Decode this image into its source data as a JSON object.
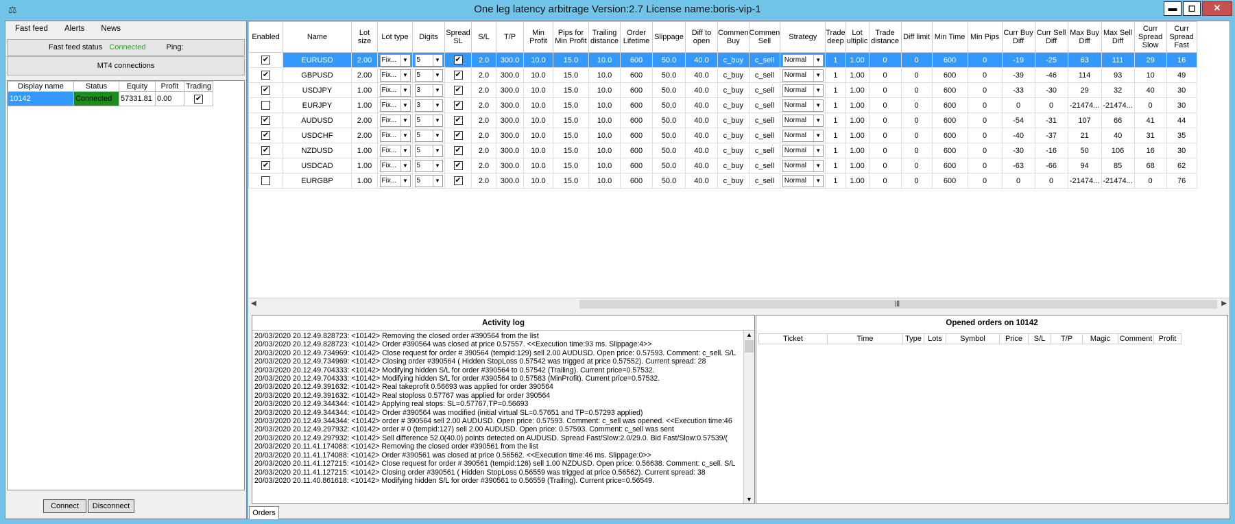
{
  "window": {
    "icon": "⚖",
    "title": "One leg latency arbitrage Version:2.7 License name:boris-vip-1",
    "min": "▬",
    "max": "◻",
    "close": "✕"
  },
  "menu": [
    "Fast feed",
    "Alerts",
    "News"
  ],
  "feed": {
    "status_label": "Fast feed status",
    "status_value": "Connected",
    "status_color": "#2e9e2e",
    "ping_label": "Ping:"
  },
  "mt4_button": "MT4 connections",
  "accounts": {
    "headers": [
      "Display name",
      "Status",
      "Equity",
      "Profit",
      "Trading"
    ],
    "rows": [
      {
        "name": "10142",
        "status": "Connected",
        "equity": "57331.81",
        "profit": "0.00",
        "trading": "✔"
      }
    ]
  },
  "buttons": {
    "connect": "Connect",
    "disconnect": "Disconnect"
  },
  "grid": {
    "headers": [
      "Enabled",
      "Name",
      "Lot size",
      "Lot type",
      "Digits",
      "Spread SL",
      "S/L",
      "T/P",
      "Min Profit",
      "Pips for Min Profit",
      "Trailing distance",
      "Order Lifetime",
      "Slippage",
      "Diff to open",
      "Commen Buy",
      "Commen Sell",
      "Strategy",
      "Trade deep",
      "Lot ultiplic",
      "Trade distance",
      "Diff limit",
      "Min Time",
      "Min Pips",
      "Curr Buy Diff",
      "Curr Sell Diff",
      "Max Buy Diff",
      "Max Sell Diff",
      "Curr Spread Slow",
      "Curr Spread Fast"
    ],
    "rows": [
      [
        "✔",
        "EURUSD",
        "2.00",
        "Fix...",
        "5",
        "✔",
        "2.0",
        "300.0",
        "10.0",
        "15.0",
        "10.0",
        "600",
        "50.0",
        "40.0",
        "c_buy",
        "c_sell",
        "Normal",
        "1",
        "1.00",
        "0",
        "0",
        "600",
        "0",
        "-19",
        "-25",
        "63",
        "111",
        "29",
        "16"
      ],
      [
        "✔",
        "GBPUSD",
        "2.00",
        "Fix...",
        "5",
        "✔",
        "2.0",
        "300.0",
        "10.0",
        "15.0",
        "10.0",
        "600",
        "50.0",
        "40.0",
        "c_buy",
        "c_sell",
        "Normal",
        "1",
        "1.00",
        "0",
        "0",
        "600",
        "0",
        "-39",
        "-46",
        "114",
        "93",
        "10",
        "49"
      ],
      [
        "✔",
        "USDJPY",
        "1.00",
        "Fix...",
        "3",
        "✔",
        "2.0",
        "300.0",
        "10.0",
        "15.0",
        "10.0",
        "600",
        "50.0",
        "40.0",
        "c_buy",
        "c_sell",
        "Normal",
        "1",
        "1.00",
        "0",
        "0",
        "600",
        "0",
        "-33",
        "-30",
        "29",
        "32",
        "40",
        "30"
      ],
      [
        "",
        "EURJPY",
        "1.00",
        "Fix...",
        "3",
        "✔",
        "2.0",
        "300.0",
        "10.0",
        "15.0",
        "10.0",
        "600",
        "50.0",
        "40.0",
        "c_buy",
        "c_sell",
        "Normal",
        "1",
        "1.00",
        "0",
        "0",
        "600",
        "0",
        "0",
        "0",
        "-21474...",
        "-21474...",
        "0",
        "30"
      ],
      [
        "✔",
        "AUDUSD",
        "2.00",
        "Fix...",
        "5",
        "✔",
        "2.0",
        "300.0",
        "10.0",
        "15.0",
        "10.0",
        "600",
        "50.0",
        "40.0",
        "c_buy",
        "c_sell",
        "Normal",
        "1",
        "1.00",
        "0",
        "0",
        "600",
        "0",
        "-54",
        "-31",
        "107",
        "66",
        "41",
        "44"
      ],
      [
        "✔",
        "USDCHF",
        "2.00",
        "Fix...",
        "5",
        "✔",
        "2.0",
        "300.0",
        "10.0",
        "15.0",
        "10.0",
        "600",
        "50.0",
        "40.0",
        "c_buy",
        "c_sell",
        "Normal",
        "1",
        "1.00",
        "0",
        "0",
        "600",
        "0",
        "-40",
        "-37",
        "21",
        "40",
        "31",
        "35"
      ],
      [
        "✔",
        "NZDUSD",
        "1.00",
        "Fix...",
        "5",
        "✔",
        "2.0",
        "300.0",
        "10.0",
        "15.0",
        "10.0",
        "600",
        "50.0",
        "40.0",
        "c_buy",
        "c_sell",
        "Normal",
        "1",
        "1.00",
        "0",
        "0",
        "600",
        "0",
        "-30",
        "-16",
        "50",
        "106",
        "16",
        "30"
      ],
      [
        "✔",
        "USDCAD",
        "1.00",
        "Fix...",
        "5",
        "✔",
        "2.0",
        "300.0",
        "10.0",
        "15.0",
        "10.0",
        "600",
        "50.0",
        "40.0",
        "c_buy",
        "c_sell",
        "Normal",
        "1",
        "1.00",
        "0",
        "0",
        "600",
        "0",
        "-63",
        "-66",
        "94",
        "85",
        "68",
        "62"
      ],
      [
        "",
        "EURGBP",
        "1.00",
        "Fix...",
        "5",
        "✔",
        "2.0",
        "300.0",
        "10.0",
        "15.0",
        "10.0",
        "600",
        "50.0",
        "40.0",
        "c_buy",
        "c_sell",
        "Normal",
        "1",
        "1.00",
        "0",
        "0",
        "600",
        "0",
        "0",
        "0",
        "-21474...",
        "-21474...",
        "0",
        "76"
      ]
    ]
  },
  "activity": {
    "title": "Activity log",
    "lines": [
      "20/03/2020 20.12.49.828723: <10142> Removing the closed order #390564 from the list",
      "20/03/2020 20.12.49.828723: <10142> Order #390564 was closed at price 0.57557. <<Execution time:93 ms. Slippage:4>>",
      "20/03/2020 20.12.49.734969: <10142> Close request for order # 390564 (tempid:129) sell 2.00 AUDUSD. Open price: 0.57593. Comment: c_sell. S/L",
      "20/03/2020 20.12.49.734969: <10142> Closing order #390564 ( Hidden StopLoss 0.57542 was trigged at price 0.57552). Current spread: 28",
      "20/03/2020 20.12.49.704333: <10142> Modifying hidden S/L for order #390564 to 0.57542 (Trailing). Current price=0.57532.",
      "20/03/2020 20.12.49.704333: <10142> Modifying hidden S/L for order #390564 to 0.57583 (MinProfit). Current price=0.57532.",
      "20/03/2020 20.12.49.391632: <10142> Real takeprofit 0.56693 was applied for order 390564",
      "20/03/2020 20.12.49.391632: <10142> Real stoploss 0.57767 was applied for order 390564",
      "20/03/2020 20.12.49.344344: <10142> Applying real stops: SL=0.57767,TP=0.56693",
      "20/03/2020 20.12.49.344344: <10142> Order #390564 was modified (initial virtual SL=0.57651 and TP=0.57293 applied)",
      "20/03/2020 20.12.49.344344: <10142> order # 390564 sell 2.00 AUDUSD. Open price: 0.57593. Comment: c_sell was opened. <<Execution time:46",
      "20/03/2020 20.12.49.297932: <10142> order # 0 (tempid:127) sell 2.00 AUDUSD. Open price: 0.57593. Comment: c_sell was sent",
      "20/03/2020 20.12.49.297932: <10142> Sell difference 52.0(40.0) points detected on AUDUSD. Spread Fast/Slow:2.0/29.0. Bid Fast/Slow:0.57539/(",
      "20/03/2020 20.11.41.174088: <10142> Removing the closed order #390561 from the list",
      "20/03/2020 20.11.41.174088: <10142> Order #390561 was closed at price 0.56562. <<Execution time:46 ms. Slippage:0>>",
      "20/03/2020 20.11.41.127215: <10142> Close request for order # 390561 (tempid:126) sell 1.00 NZDUSD. Open price: 0.56638. Comment: c_sell. S/L",
      "20/03/2020 20.11.41.127215: <10142> Closing order #390561 ( Hidden StopLoss 0.56559 was trigged at price 0.56562). Current spread: 38",
      "20/03/2020 20.11.40.861618: <10142> Modifying hidden S/L for order #390561 to 0.56559 (Trailing). Current price=0.56549."
    ]
  },
  "orders": {
    "title": "Opened orders on 10142",
    "headers": [
      "Ticket",
      "Time",
      "Type",
      "Lots",
      "Symbol",
      "Price",
      "S/L",
      "T/P",
      "Magic",
      "Comment",
      "Profit"
    ]
  },
  "tabs": {
    "orders": "Orders"
  },
  "colors": {
    "selected_row": "#3399ff",
    "connected_cell": "#1c8c1c",
    "title_bar": "#6fc4e8"
  }
}
